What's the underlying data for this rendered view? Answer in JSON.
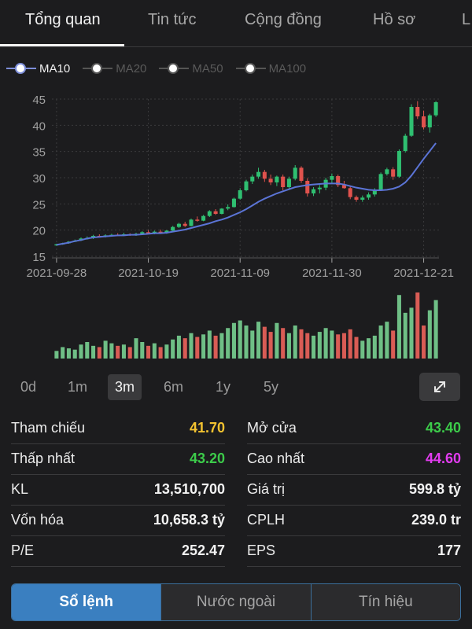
{
  "tabs": [
    {
      "label": "Tổng quan",
      "active": true
    },
    {
      "label": "Tin tức",
      "active": false
    },
    {
      "label": "Cộng đồng",
      "active": false
    },
    {
      "label": "Hồ sơ",
      "active": false
    },
    {
      "label": "L",
      "active": false
    }
  ],
  "legend": [
    {
      "label": "MA10",
      "enabled": true
    },
    {
      "label": "MA20",
      "enabled": false
    },
    {
      "label": "MA50",
      "enabled": false
    },
    {
      "label": "MA100",
      "enabled": false
    }
  ],
  "ranges": [
    {
      "label": "0d",
      "active": false
    },
    {
      "label": "1m",
      "active": false
    },
    {
      "label": "3m",
      "active": true
    },
    {
      "label": "6m",
      "active": false
    },
    {
      "label": "1y",
      "active": false
    },
    {
      "label": "5y",
      "active": false
    }
  ],
  "expand_icon": "expand-arrows-icon",
  "stats": [
    [
      {
        "label": "Tham chiếu",
        "value": "41.70",
        "color": "#f2c230"
      },
      {
        "label": "Mở cửa",
        "value": "43.40",
        "color": "#3ccb4a"
      }
    ],
    [
      {
        "label": "Thấp nhất",
        "value": "43.20",
        "color": "#3ccb4a"
      },
      {
        "label": "Cao nhất",
        "value": "44.60",
        "color": "#e23cf0"
      }
    ],
    [
      {
        "label": "KL",
        "value": "13,510,700",
        "color": "#f2f2f2"
      },
      {
        "label": "Giá trị",
        "value": "599.8 tỷ",
        "color": "#f2f2f2"
      }
    ],
    [
      {
        "label": "Vốn hóa",
        "value": "10,658.3 tỷ",
        "color": "#f2f2f2"
      },
      {
        "label": "CPLH",
        "value": "239.0 tr",
        "color": "#f2f2f2"
      }
    ],
    [
      {
        "label": "P/E",
        "value": "252.47",
        "color": "#f2f2f2"
      },
      {
        "label": "EPS",
        "value": "177",
        "color": "#f2f2f2"
      }
    ]
  ],
  "bottom_tabs": [
    {
      "label": "Sổ lệnh",
      "active": true
    },
    {
      "label": "Nước ngoài",
      "active": false
    },
    {
      "label": "Tín hiệu",
      "active": false
    }
  ],
  "chart_data": {
    "type": "candlestick",
    "y_ticks": [
      "45",
      "40",
      "35",
      "30",
      "25",
      "20",
      "15"
    ],
    "ylim": [
      15,
      46
    ],
    "x_ticks": [
      {
        "label": "2021-09-28",
        "index": 0
      },
      {
        "label": "2021-10-19",
        "index": 15
      },
      {
        "label": "2021-11-09",
        "index": 30
      },
      {
        "label": "2021-11-30",
        "index": 45
      },
      {
        "label": "2021-12-21",
        "index": 60
      }
    ],
    "colors": {
      "up": "#2fbf71",
      "down": "#e0524d",
      "ma": "#5b74d6",
      "volume_up": "#6fbf86",
      "volume_down": "#d95c55",
      "grid": "#3a3a3c",
      "axis_text": "#a0a0a0"
    },
    "candles": [
      [
        17.1,
        17.4,
        17.0,
        17.3
      ],
      [
        17.3,
        17.6,
        17.2,
        17.5
      ],
      [
        17.5,
        17.9,
        17.4,
        17.8
      ],
      [
        17.8,
        18.2,
        17.7,
        18.0
      ],
      [
        18.0,
        18.6,
        17.9,
        18.4
      ],
      [
        18.4,
        18.8,
        18.2,
        18.5
      ],
      [
        18.5,
        19.1,
        18.3,
        18.9
      ],
      [
        18.9,
        19.2,
        18.6,
        18.7
      ],
      [
        18.7,
        19.2,
        18.6,
        19.0
      ],
      [
        19.0,
        19.3,
        18.8,
        19.1
      ],
      [
        19.1,
        19.4,
        18.9,
        19.0
      ],
      [
        19.0,
        19.5,
        18.9,
        19.2
      ],
      [
        19.2,
        19.4,
        18.9,
        19.0
      ],
      [
        19.0,
        19.5,
        18.9,
        19.3
      ],
      [
        19.3,
        19.8,
        19.2,
        19.6
      ],
      [
        19.6,
        20.0,
        19.3,
        19.4
      ],
      [
        19.4,
        19.9,
        19.2,
        19.7
      ],
      [
        19.7,
        20.1,
        19.4,
        19.5
      ],
      [
        19.5,
        20.0,
        19.3,
        19.9
      ],
      [
        19.9,
        20.8,
        19.8,
        20.6
      ],
      [
        20.6,
        21.4,
        20.4,
        21.2
      ],
      [
        21.2,
        21.6,
        20.6,
        20.8
      ],
      [
        20.8,
        22.2,
        20.7,
        22.0
      ],
      [
        22.0,
        22.6,
        21.6,
        21.8
      ],
      [
        21.8,
        22.9,
        21.7,
        22.7
      ],
      [
        22.7,
        23.8,
        22.5,
        23.6
      ],
      [
        23.6,
        24.0,
        22.9,
        23.1
      ],
      [
        23.1,
        24.2,
        23.0,
        24.1
      ],
      [
        24.1,
        24.9,
        23.8,
        24.4
      ],
      [
        24.4,
        26.2,
        24.3,
        26.0
      ],
      [
        26.0,
        28.0,
        25.8,
        27.6
      ],
      [
        27.6,
        29.6,
        27.4,
        29.3
      ],
      [
        29.3,
        30.6,
        28.8,
        30.2
      ],
      [
        30.2,
        31.9,
        29.8,
        31.1
      ],
      [
        31.1,
        31.5,
        29.2,
        29.8
      ],
      [
        29.8,
        30.6,
        28.6,
        29.1
      ],
      [
        29.1,
        30.4,
        28.4,
        30.2
      ],
      [
        30.2,
        30.6,
        27.6,
        28.2
      ],
      [
        28.2,
        30.2,
        27.8,
        29.8
      ],
      [
        29.8,
        32.4,
        29.5,
        31.9
      ],
      [
        31.9,
        32.2,
        29.0,
        29.4
      ],
      [
        29.4,
        29.9,
        26.4,
        27.0
      ],
      [
        27.0,
        28.2,
        26.5,
        27.8
      ],
      [
        27.8,
        28.6,
        27.0,
        28.1
      ],
      [
        28.1,
        30.0,
        27.6,
        29.6
      ],
      [
        29.6,
        30.8,
        29.0,
        30.3
      ],
      [
        30.3,
        30.6,
        28.2,
        28.6
      ],
      [
        28.6,
        29.4,
        27.9,
        28.0
      ],
      [
        28.0,
        28.4,
        25.9,
        26.3
      ],
      [
        26.3,
        26.6,
        25.4,
        25.8
      ],
      [
        25.8,
        26.6,
        25.4,
        26.2
      ],
      [
        26.2,
        27.2,
        25.8,
        26.8
      ],
      [
        26.8,
        28.0,
        26.4,
        27.6
      ],
      [
        27.6,
        31.0,
        27.5,
        30.7
      ],
      [
        30.7,
        31.9,
        30.4,
        31.6
      ],
      [
        31.6,
        32.0,
        29.6,
        30.2
      ],
      [
        30.2,
        35.4,
        30.0,
        35.1
      ],
      [
        35.1,
        38.4,
        34.8,
        38.0
      ],
      [
        38.0,
        44.0,
        37.8,
        43.5
      ],
      [
        43.5,
        44.6,
        41.2,
        41.7
      ],
      [
        41.7,
        42.8,
        39.2,
        39.6
      ],
      [
        39.6,
        42.2,
        38.6,
        41.9
      ],
      [
        41.9,
        44.6,
        41.6,
        44.4
      ]
    ],
    "ma10": [
      17.2,
      17.4,
      17.6,
      17.9,
      18.1,
      18.4,
      18.6,
      18.7,
      18.8,
      18.9,
      19.0,
      19.0,
      19.1,
      19.1,
      19.2,
      19.3,
      19.4,
      19.4,
      19.5,
      19.7,
      19.9,
      20.1,
      20.4,
      20.7,
      21.0,
      21.3,
      21.7,
      22.0,
      22.4,
      22.9,
      23.4,
      24.0,
      24.7,
      25.4,
      26.0,
      26.5,
      27.0,
      27.4,
      27.8,
      28.2,
      28.4,
      28.6,
      28.7,
      28.8,
      28.9,
      28.9,
      28.9,
      28.7,
      28.4,
      28.1,
      27.9,
      27.7,
      27.6,
      27.6,
      27.7,
      27.9,
      28.3,
      29.1,
      30.4,
      32.0,
      33.6,
      35.1,
      36.6
    ],
    "volume": [
      0.6,
      0.9,
      0.8,
      0.7,
      1.1,
      1.3,
      1.0,
      0.9,
      1.4,
      1.2,
      1.0,
      1.1,
      0.9,
      1.6,
      1.3,
      1.0,
      1.2,
      0.9,
      1.1,
      1.5,
      1.8,
      1.6,
      2.0,
      1.7,
      1.9,
      2.2,
      1.8,
      2.0,
      2.4,
      2.8,
      3.0,
      2.6,
      2.2,
      2.9,
      2.5,
      2.1,
      2.8,
      2.4,
      2.0,
      2.6,
      2.3,
      2.0,
      1.8,
      2.1,
      2.4,
      2.2,
      1.9,
      2.0,
      2.3,
      1.7,
      1.4,
      1.6,
      1.8,
      2.6,
      2.9,
      2.2,
      5.0,
      3.6,
      4.0,
      5.2,
      2.6,
      3.8,
      4.6
    ]
  }
}
